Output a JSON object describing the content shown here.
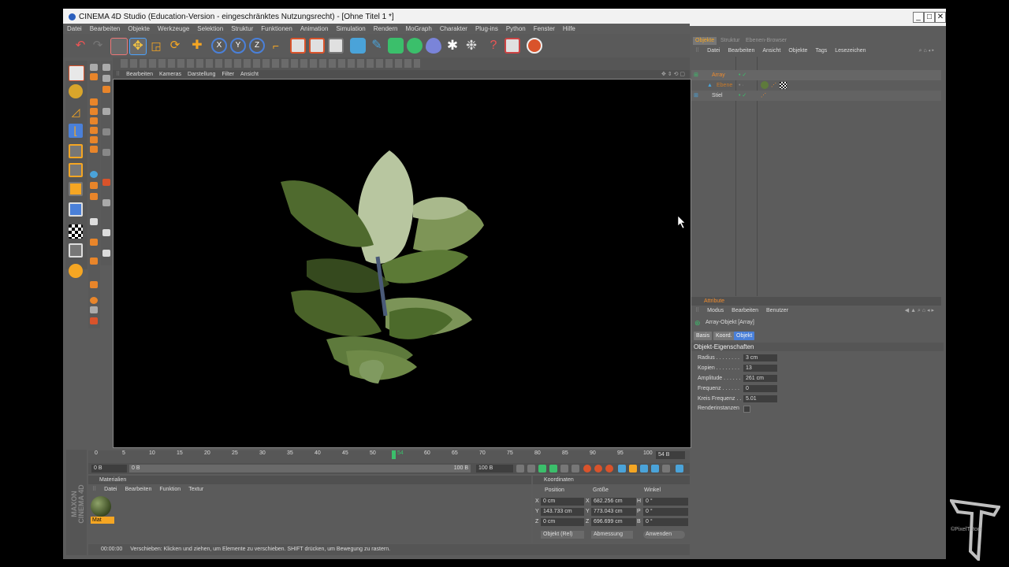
{
  "window": {
    "title": "CINEMA 4D Studio (Education-Version - eingeschränktes Nutzungsrecht) - [Ohne Titel 1 *]",
    "controls": {
      "minimize": "_",
      "maximize": "□",
      "close": "✕"
    }
  },
  "menu": [
    "Datei",
    "Bearbeiten",
    "Objekte",
    "Werkzeuge",
    "Selektion",
    "Struktur",
    "Funktionen",
    "Animation",
    "Simulation",
    "Rendern",
    "MoGraph",
    "Charakter",
    "Plug-ins",
    "Python",
    "Fenster",
    "Hilfe"
  ],
  "viewport": {
    "menu": [
      "Bearbeiten",
      "Kameras",
      "Darstellung",
      "Filter",
      "Ansicht"
    ]
  },
  "timeline": {
    "ticks": [
      "0",
      "5",
      "10",
      "15",
      "20",
      "25",
      "30",
      "35",
      "40",
      "45",
      "50",
      "",
      "60",
      "65",
      "70",
      "75",
      "80",
      "85",
      "90",
      "95",
      "100"
    ],
    "current_frame": "54",
    "frame_display": "54 B",
    "start_field": "0 B",
    "range_start": "0 B",
    "range_end": "100 B",
    "end_field": "100 B"
  },
  "materials": {
    "title": "Materialien",
    "menu": [
      "Datei",
      "Bearbeiten",
      "Funktion",
      "Textur"
    ],
    "items": [
      {
        "label": "Mat"
      }
    ]
  },
  "coordinates": {
    "title": "Koordinaten",
    "headers": [
      "Position",
      "Größe",
      "Winkel"
    ],
    "rows": [
      {
        "axis": "X",
        "pos": "0 cm",
        "size_axis": "X",
        "size": "682.256 cm",
        "angle_axis": "H",
        "angle": "0 °"
      },
      {
        "axis": "Y",
        "pos": "143.733 cm",
        "size_axis": "Y",
        "size": "773.043 cm",
        "angle_axis": "P",
        "angle": "0 °"
      },
      {
        "axis": "Z",
        "pos": "0 cm",
        "size_axis": "Z",
        "size": "696.699 cm",
        "angle_axis": "B",
        "angle": "0 °"
      }
    ],
    "mode_select": "Objekt (Rel)",
    "size_select": "Abmessung",
    "apply": "Anwenden"
  },
  "status": {
    "time": "00:00:00",
    "text": "Verschieben: Klicken und ziehen, um Elemente zu verschieben. SHIFT drücken, um Bewegung zu rastern."
  },
  "brand": {
    "line1": "MAXON",
    "line2": "CINEMA 4D"
  },
  "objects_panel": {
    "tabs": [
      "Objekte",
      "Struktur",
      "Ebenen-Browser"
    ],
    "menu": [
      "Datei",
      "Bearbeiten",
      "Ansicht",
      "Objekte",
      "Tags",
      "Lesezeichen"
    ],
    "items": [
      {
        "name": "Array",
        "color": "#f08c2e"
      },
      {
        "name": "Ebene",
        "color": "#c87a2a"
      },
      {
        "name": "Stiel",
        "color": "#dddddd"
      }
    ]
  },
  "attributes": {
    "title": "Attribute",
    "menu": [
      "Modus",
      "Bearbeiten",
      "Benutzer"
    ],
    "object_label": "Array-Objekt [Array]",
    "tabs": [
      "Basis",
      "Koord.",
      "Objekt"
    ],
    "section": "Objekt-Eigenschaften",
    "props": [
      {
        "label": "Radius . . . . . . . .",
        "value": "3 cm"
      },
      {
        "label": "Kopien . . . . . . . .",
        "value": "13"
      },
      {
        "label": "Amplitude . . . . . .",
        "value": "261 cm"
      },
      {
        "label": "Frequenz . . . . . .",
        "value": "0"
      },
      {
        "label": "Kreis Frequenz . .",
        "value": "5.01"
      },
      {
        "label": "Renderinstanzen",
        "value": ""
      }
    ]
  },
  "watermark": "©PixelTutors",
  "colors": {
    "accent": "#f08c2e",
    "panel": "#5c5c5c",
    "viewport": "#000000",
    "leaf": "#5e7a3c"
  }
}
